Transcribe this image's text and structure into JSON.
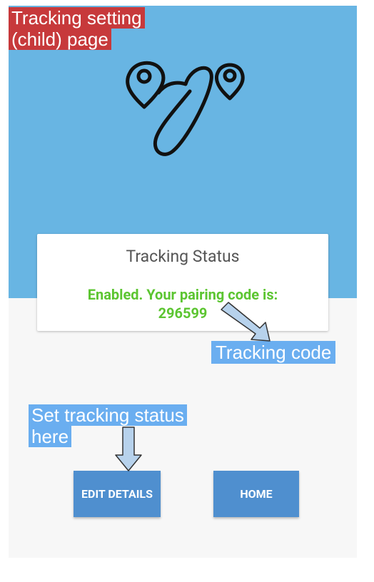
{
  "annotations": {
    "page_label_line1": "Tracking setting",
    "page_label_line2": "(child) page",
    "tracking_code_label": "Tracking code",
    "set_status_line1": "Set tracking status",
    "set_status_line2": "here"
  },
  "card": {
    "title": "Tracking Status",
    "status_line1": "Enabled. Your pairing code is:",
    "status_line2": "296599"
  },
  "buttons": {
    "edit_label": "EDIT DETAILS",
    "home_label": "HOME"
  },
  "colors": {
    "hero_bg": "#68b5e3",
    "status_green": "#5cc531",
    "button_blue": "#4f8fcf",
    "annotation_red": "#c7393b",
    "annotation_blue": "#6aaef0"
  }
}
